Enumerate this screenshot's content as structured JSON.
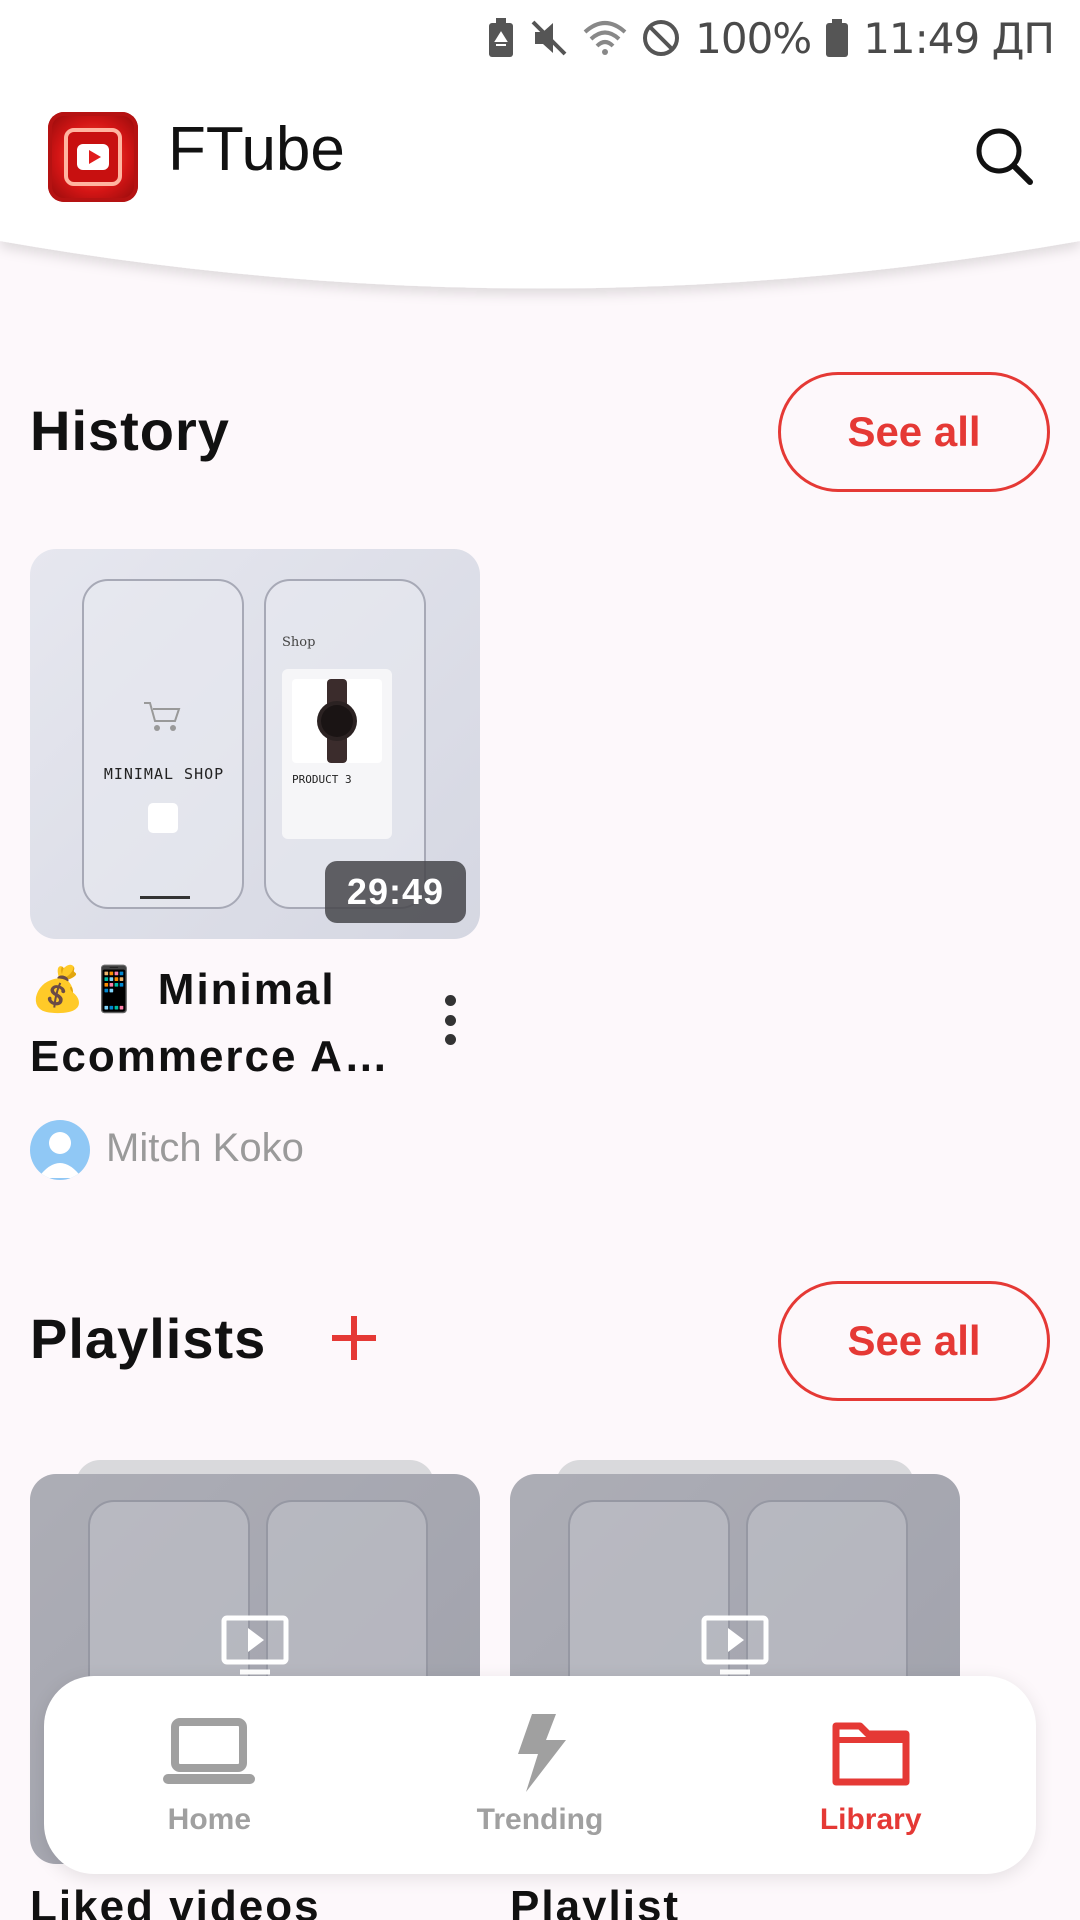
{
  "status_bar": {
    "battery_percent": "100%",
    "time": "11:49 ДП",
    "icons": [
      "battery-saver-icon",
      "mute-icon",
      "wifi-icon",
      "no-disturb-icon",
      "battery-icon"
    ]
  },
  "app_bar": {
    "title": "FTube",
    "logo_icon": "ftube-logo-icon",
    "search_icon": "search-icon"
  },
  "history": {
    "title": "History",
    "see_all_label": "See all",
    "videos": [
      {
        "title": "💰📱 Minimal Ecommerce A…",
        "duration": "29:49",
        "channel": "Mitch Koko",
        "thumbnail_texts": {
          "left_heading": "MINIMAL SHOP",
          "right_heading": "Shop",
          "product": "PRODUCT 3"
        }
      }
    ]
  },
  "playlists": {
    "title": "Playlists",
    "see_all_label": "See all",
    "add_icon": "plus-icon",
    "items": [
      {
        "label": "Liked videos"
      },
      {
        "label": "Playlist"
      }
    ]
  },
  "bottom_nav": {
    "items": [
      {
        "label": "Home",
        "icon": "laptop-icon",
        "active": false
      },
      {
        "label": "Trending",
        "icon": "lightning-icon",
        "active": false
      },
      {
        "label": "Library",
        "icon": "folder-icon",
        "active": true
      }
    ]
  },
  "colors": {
    "accent": "#e53935",
    "inactive": "#a0a0a0",
    "background": "#fdf8fb"
  }
}
